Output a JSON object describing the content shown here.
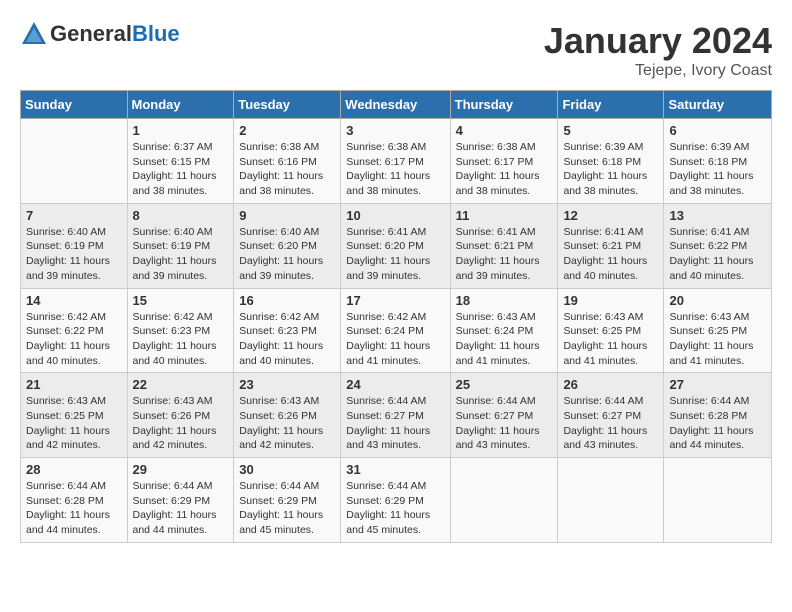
{
  "header": {
    "logo_general": "General",
    "logo_blue": "Blue",
    "month": "January 2024",
    "location": "Tejepe, Ivory Coast"
  },
  "weekdays": [
    "Sunday",
    "Monday",
    "Tuesday",
    "Wednesday",
    "Thursday",
    "Friday",
    "Saturday"
  ],
  "weeks": [
    [
      {
        "day": "",
        "info": ""
      },
      {
        "day": "1",
        "info": "Sunrise: 6:37 AM\nSunset: 6:15 PM\nDaylight: 11 hours and 38 minutes."
      },
      {
        "day": "2",
        "info": "Sunrise: 6:38 AM\nSunset: 6:16 PM\nDaylight: 11 hours and 38 minutes."
      },
      {
        "day": "3",
        "info": "Sunrise: 6:38 AM\nSunset: 6:17 PM\nDaylight: 11 hours and 38 minutes."
      },
      {
        "day": "4",
        "info": "Sunrise: 6:38 AM\nSunset: 6:17 PM\nDaylight: 11 hours and 38 minutes."
      },
      {
        "day": "5",
        "info": "Sunrise: 6:39 AM\nSunset: 6:18 PM\nDaylight: 11 hours and 38 minutes."
      },
      {
        "day": "6",
        "info": "Sunrise: 6:39 AM\nSunset: 6:18 PM\nDaylight: 11 hours and 38 minutes."
      }
    ],
    [
      {
        "day": "7",
        "info": "Sunrise: 6:40 AM\nSunset: 6:19 PM\nDaylight: 11 hours and 39 minutes."
      },
      {
        "day": "8",
        "info": "Sunrise: 6:40 AM\nSunset: 6:19 PM\nDaylight: 11 hours and 39 minutes."
      },
      {
        "day": "9",
        "info": "Sunrise: 6:40 AM\nSunset: 6:20 PM\nDaylight: 11 hours and 39 minutes."
      },
      {
        "day": "10",
        "info": "Sunrise: 6:41 AM\nSunset: 6:20 PM\nDaylight: 11 hours and 39 minutes."
      },
      {
        "day": "11",
        "info": "Sunrise: 6:41 AM\nSunset: 6:21 PM\nDaylight: 11 hours and 39 minutes."
      },
      {
        "day": "12",
        "info": "Sunrise: 6:41 AM\nSunset: 6:21 PM\nDaylight: 11 hours and 40 minutes."
      },
      {
        "day": "13",
        "info": "Sunrise: 6:41 AM\nSunset: 6:22 PM\nDaylight: 11 hours and 40 minutes."
      }
    ],
    [
      {
        "day": "14",
        "info": "Sunrise: 6:42 AM\nSunset: 6:22 PM\nDaylight: 11 hours and 40 minutes."
      },
      {
        "day": "15",
        "info": "Sunrise: 6:42 AM\nSunset: 6:23 PM\nDaylight: 11 hours and 40 minutes."
      },
      {
        "day": "16",
        "info": "Sunrise: 6:42 AM\nSunset: 6:23 PM\nDaylight: 11 hours and 40 minutes."
      },
      {
        "day": "17",
        "info": "Sunrise: 6:42 AM\nSunset: 6:24 PM\nDaylight: 11 hours and 41 minutes."
      },
      {
        "day": "18",
        "info": "Sunrise: 6:43 AM\nSunset: 6:24 PM\nDaylight: 11 hours and 41 minutes."
      },
      {
        "day": "19",
        "info": "Sunrise: 6:43 AM\nSunset: 6:25 PM\nDaylight: 11 hours and 41 minutes."
      },
      {
        "day": "20",
        "info": "Sunrise: 6:43 AM\nSunset: 6:25 PM\nDaylight: 11 hours and 41 minutes."
      }
    ],
    [
      {
        "day": "21",
        "info": "Sunrise: 6:43 AM\nSunset: 6:25 PM\nDaylight: 11 hours and 42 minutes."
      },
      {
        "day": "22",
        "info": "Sunrise: 6:43 AM\nSunset: 6:26 PM\nDaylight: 11 hours and 42 minutes."
      },
      {
        "day": "23",
        "info": "Sunrise: 6:43 AM\nSunset: 6:26 PM\nDaylight: 11 hours and 42 minutes."
      },
      {
        "day": "24",
        "info": "Sunrise: 6:44 AM\nSunset: 6:27 PM\nDaylight: 11 hours and 43 minutes."
      },
      {
        "day": "25",
        "info": "Sunrise: 6:44 AM\nSunset: 6:27 PM\nDaylight: 11 hours and 43 minutes."
      },
      {
        "day": "26",
        "info": "Sunrise: 6:44 AM\nSunset: 6:27 PM\nDaylight: 11 hours and 43 minutes."
      },
      {
        "day": "27",
        "info": "Sunrise: 6:44 AM\nSunset: 6:28 PM\nDaylight: 11 hours and 44 minutes."
      }
    ],
    [
      {
        "day": "28",
        "info": "Sunrise: 6:44 AM\nSunset: 6:28 PM\nDaylight: 11 hours and 44 minutes."
      },
      {
        "day": "29",
        "info": "Sunrise: 6:44 AM\nSunset: 6:29 PM\nDaylight: 11 hours and 44 minutes."
      },
      {
        "day": "30",
        "info": "Sunrise: 6:44 AM\nSunset: 6:29 PM\nDaylight: 11 hours and 45 minutes."
      },
      {
        "day": "31",
        "info": "Sunrise: 6:44 AM\nSunset: 6:29 PM\nDaylight: 11 hours and 45 minutes."
      },
      {
        "day": "",
        "info": ""
      },
      {
        "day": "",
        "info": ""
      },
      {
        "day": "",
        "info": ""
      }
    ]
  ]
}
